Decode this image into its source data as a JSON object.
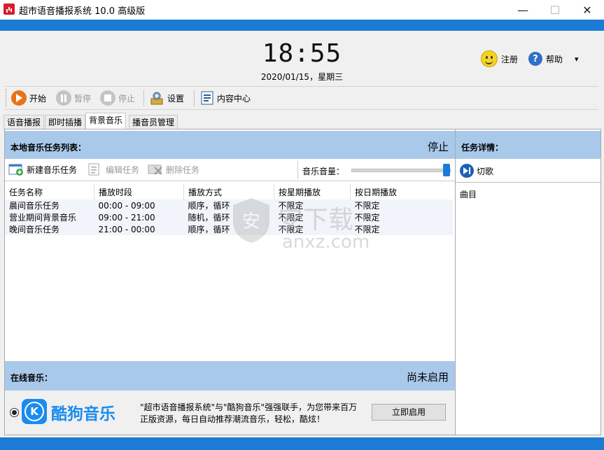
{
  "window": {
    "title": "超市语音播报系统 10.0 高级版",
    "minimize": "—",
    "maximize": "☐",
    "close": "✕"
  },
  "clock": {
    "time": "18:55",
    "date": "2020/01/15，星期三"
  },
  "topright": {
    "register": "注册",
    "help": "帮助",
    "dropdown": "▾"
  },
  "toolbar": {
    "start": "开始",
    "pause": "暂停",
    "stop": "停止",
    "settings": "设置",
    "content_center": "内容中心"
  },
  "tabs": [
    "语音播报",
    "即时插播",
    "背景音乐",
    "播音员管理"
  ],
  "active_tab": "背景音乐",
  "local_music": {
    "header": "本地音乐任务列表：",
    "status": "停止",
    "new_task": "新建音乐任务",
    "edit_task": "编辑任务",
    "delete_task": "删除任务",
    "volume_label": "音乐音量：",
    "volume": 1.0,
    "columns": [
      "任务名称",
      "播放时段",
      "播放方式",
      "按星期播放",
      "按日期播放"
    ],
    "rows": [
      [
        "晨间音乐任务",
        "00:00 - 09:00",
        "顺序，循环",
        "不限定",
        "不限定"
      ],
      [
        "营业期间背景音乐",
        "09:00 - 21:00",
        "随机，循环",
        "不限定",
        "不限定"
      ],
      [
        "晚间音乐任务",
        "21:00 - 00:00",
        "顺序，循环",
        "不限定",
        "不限定"
      ]
    ]
  },
  "online_music": {
    "header": "在线音乐：",
    "status": "尚未启用",
    "brand": "酷狗音乐",
    "brand_letter": "K",
    "desc_line1": "\"超市语音播报系统\"与\"酷狗音乐\"强强联手，为您带来百万",
    "desc_line2": "正版资源，每日自动推荐潮流音乐，轻松，酷炫！",
    "enable_button": "立即启用"
  },
  "task_detail": {
    "header": "任务详情：",
    "skip": "切歌",
    "track_label": "曲目"
  },
  "watermark": {
    "text": "安下载",
    "url": "anxz.com"
  },
  "colors": {
    "accent_blue": "#1c7bd4",
    "header_blue": "#a9c9ea",
    "play_orange": "#e8731a",
    "kugou_blue": "#1a8cf0"
  }
}
